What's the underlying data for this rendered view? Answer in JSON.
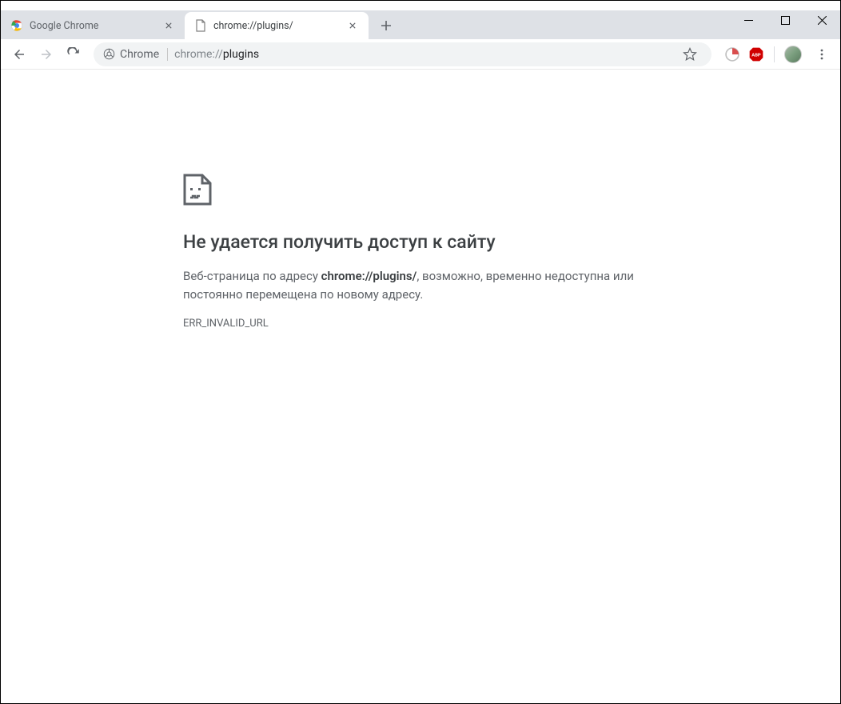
{
  "tabs": [
    {
      "title": "Google Chrome",
      "active": false
    },
    {
      "title": "chrome://plugins/",
      "active": true
    }
  ],
  "omnibox": {
    "scheme_label": "Chrome",
    "url_prefix": "chrome://",
    "url_strong": "plugins"
  },
  "error": {
    "title": "Не удается получить доступ к сайту",
    "desc_prefix": "Веб-страница по адресу ",
    "desc_bold": "chrome://plugins/",
    "desc_suffix": ", возможно, временно недоступна или постоянно перемещена по новому адресу.",
    "code": "ERR_INVALID_URL"
  }
}
